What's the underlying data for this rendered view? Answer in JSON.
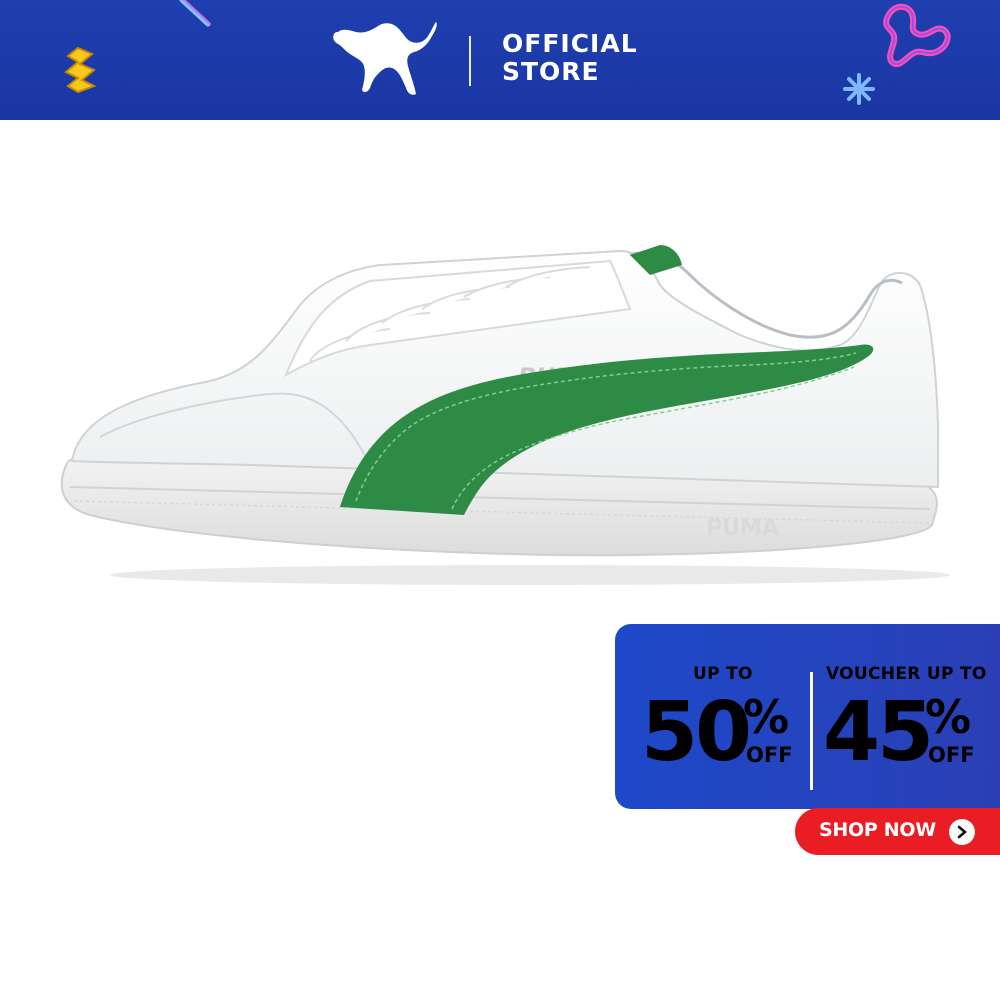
{
  "header": {
    "brand": "PUMA",
    "store_line1": "OFFICIAL",
    "store_line2": "STORE",
    "bg_color": "#1f3fb0"
  },
  "product": {
    "shoe_upper_color": "#ffffff",
    "stripe_color": "#2e8b45",
    "logo_on_side": "PUMA",
    "logo_on_sole": "PUMA"
  },
  "promo": {
    "left_label": "UP TO",
    "left_value": "50",
    "left_pct": "%",
    "left_off": "OFF",
    "right_label": "VOUCHER UP TO",
    "right_value": "45",
    "right_pct": "%",
    "right_off": "OFF",
    "bg_color": "#1e49c9"
  },
  "cta": {
    "label": "SHOP NOW",
    "icon": "chevron-right-icon",
    "bg_color": "#ea1c24"
  }
}
